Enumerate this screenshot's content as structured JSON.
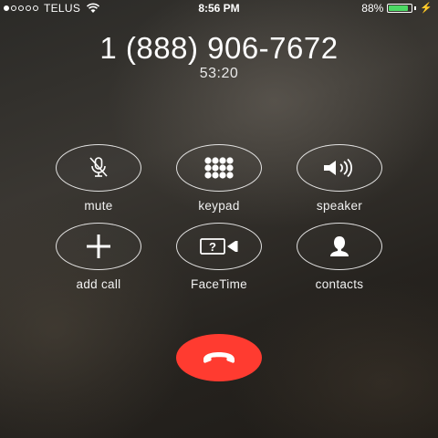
{
  "status_bar": {
    "carrier": "TELUS",
    "time": "8:56 PM",
    "battery_percent": "88%",
    "battery_level": 0.88,
    "signal_bars_filled": 1,
    "signal_bars_total": 5
  },
  "call": {
    "number": "1 (888) 906-7672",
    "duration": "53:20"
  },
  "controls": {
    "mute": {
      "label": "mute",
      "icon": "mic-muted-icon"
    },
    "keypad": {
      "label": "keypad",
      "icon": "keypad-icon"
    },
    "speaker": {
      "label": "speaker",
      "icon": "speaker-icon"
    },
    "add_call": {
      "label": "add call",
      "icon": "plus-icon"
    },
    "facetime": {
      "label": "FaceTime",
      "icon": "facetime-icon"
    },
    "contacts": {
      "label": "contacts",
      "icon": "contact-icon"
    }
  },
  "end_call": {
    "icon": "hang-up-icon",
    "color": "#ff3b30"
  },
  "colors": {
    "battery": "#4cd964",
    "end_call": "#ff3b30"
  }
}
